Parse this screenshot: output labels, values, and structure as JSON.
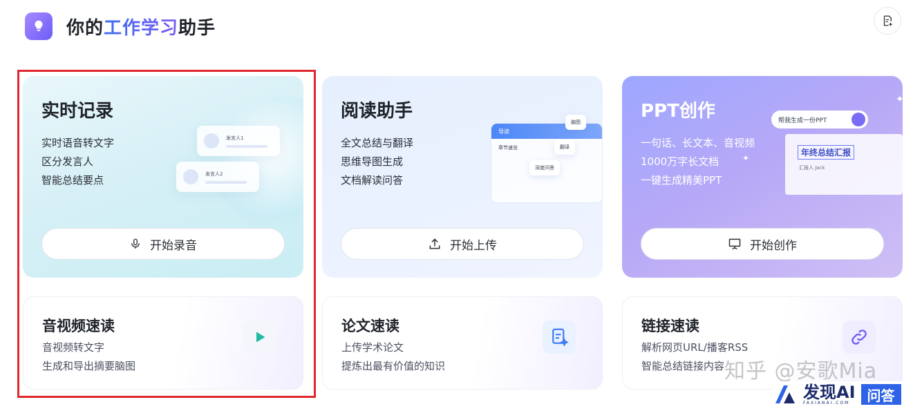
{
  "header": {
    "title_prefix": "你的",
    "title_highlight": "工作学习",
    "title_suffix": "助手",
    "logo_icon": "lightbulb-icon",
    "note_icon": "note-add-icon"
  },
  "big_cards": [
    {
      "title": "实时记录",
      "features": [
        "实时语音转文字",
        "区分发言人",
        "智能总结要点"
      ],
      "button_label": "开始录音",
      "button_icon": "microphone-icon",
      "illustration": {
        "speaker1": "发言人1",
        "speaker2": "发言人2"
      }
    },
    {
      "title": "阅读助手",
      "features": [
        "全文总结与翻译",
        "思维导图生成",
        "文档解读问答"
      ],
      "button_label": "开始上传",
      "button_icon": "upload-icon",
      "illustration": {
        "panel_title": "导读",
        "section": "章节速览",
        "mindmap": "脑图",
        "translate": "翻译",
        "qa": "深度问答"
      }
    },
    {
      "title": "PPT创作",
      "features": [
        "一句话、长文本、音视频",
        "1000万字长文档",
        "一键生成精美PPT"
      ],
      "button_label": "开始创作",
      "button_icon": "presentation-icon",
      "illustration": {
        "prompt": "帮我生成一份PPT",
        "slide_title": "年终总结汇报",
        "author": "汇报人 Jack"
      }
    }
  ],
  "small_cards": [
    {
      "title": "音视频速读",
      "features": [
        "音视频转文字",
        "生成和导出摘要脑图"
      ],
      "icon": "video-play-icon"
    },
    {
      "title": "论文速读",
      "features": [
        "上传学术论文",
        "提炼出最有价值的知识"
      ],
      "icon": "document-sparkle-icon"
    },
    {
      "title": "链接速读",
      "features": [
        "解析网页URL/播客RSS",
        "智能总结链接内容"
      ],
      "icon": "link-icon"
    }
  ],
  "overlay": {
    "watermark": "知乎 @安歌Mia",
    "brand": "发现AI",
    "brand_sub": "FAXIANAI.COM",
    "brand_badge": "问答"
  },
  "colors": {
    "accent": "#6b5cf6",
    "highlight_start": "#3d6cf5",
    "highlight_end": "#7b5cf0",
    "selection_border": "#e0272e",
    "ppt_card": "#b7a8f7"
  }
}
